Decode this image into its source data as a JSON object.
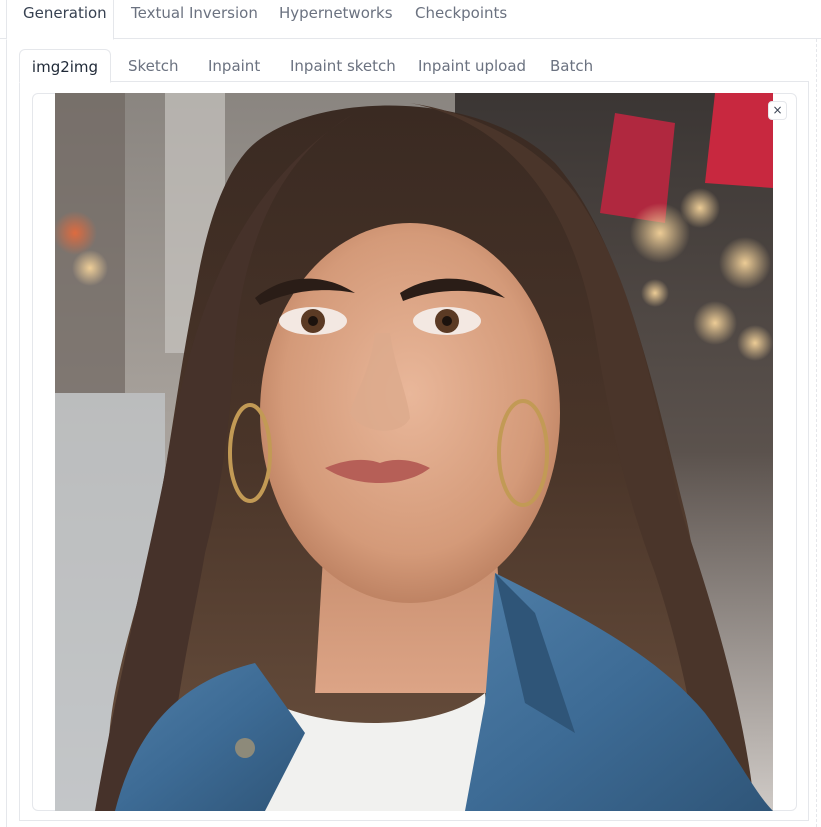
{
  "top_tabs": [
    {
      "label": "Generation",
      "selected": true
    },
    {
      "label": "Textual Inversion",
      "selected": false
    },
    {
      "label": "Hypernetworks",
      "selected": false
    },
    {
      "label": "Checkpoints",
      "selected": false
    }
  ],
  "sub_tabs": [
    {
      "label": "img2img",
      "selected": true
    },
    {
      "label": "Sketch",
      "selected": false
    },
    {
      "label": "Inpaint",
      "selected": false
    },
    {
      "label": "Inpaint sketch",
      "selected": false
    },
    {
      "label": "Inpaint upload",
      "selected": false
    },
    {
      "label": "Batch",
      "selected": false
    }
  ],
  "image_panel": {
    "close_glyph": "×",
    "close_icon": "close-icon",
    "image_subject": "portrait photo of a young woman in a denim jacket on a city street"
  },
  "colors": {
    "border": "#e5e7eb",
    "tab_text": "#6b7280",
    "tab_text_selected": "#1f2937"
  }
}
